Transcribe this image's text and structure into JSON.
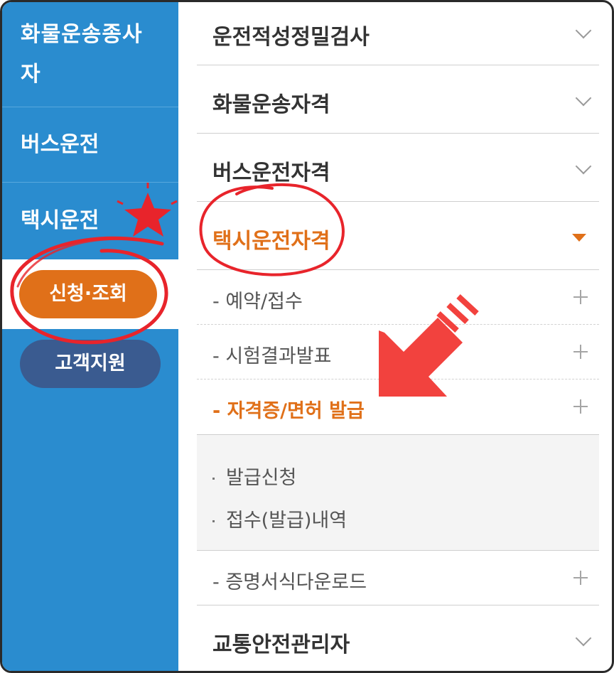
{
  "sidebar": {
    "items": [
      {
        "label": "화물운송종사자"
      },
      {
        "label": "버스운전"
      },
      {
        "label": "택시운전"
      }
    ],
    "apply_button": "신청·조회",
    "support_button": "고객지원"
  },
  "menu": {
    "items": [
      {
        "label": "운전적성정밀검사",
        "icon": "chevron-down-icon"
      },
      {
        "label": "화물운송자격",
        "icon": "chevron-down-icon"
      },
      {
        "label": "버스운전자격",
        "icon": "chevron-down-icon"
      },
      {
        "label": "택시운전자격",
        "icon": "triangle-down-icon",
        "active": true
      },
      {
        "label": "교통안전관리자",
        "icon": "chevron-down-icon"
      }
    ],
    "taxi_submenu": [
      {
        "label": "- 예약/접수",
        "icon": "plus-icon"
      },
      {
        "label": "- 시험결과발표",
        "icon": "plus-icon"
      },
      {
        "label": "- 자격증/면허 발급",
        "icon": "plus-icon",
        "active": true
      },
      {
        "label": "- 증명서식다운로드",
        "icon": "plus-icon"
      }
    ],
    "issue_submenu": [
      {
        "label": "발급신청"
      },
      {
        "label": "접수(발급)내역"
      }
    ]
  },
  "colors": {
    "sidebar_bg": "#2a8ccf",
    "accent_orange": "#e07019",
    "support_pill": "#3a5b90",
    "annotation_red": "#e8242b"
  }
}
